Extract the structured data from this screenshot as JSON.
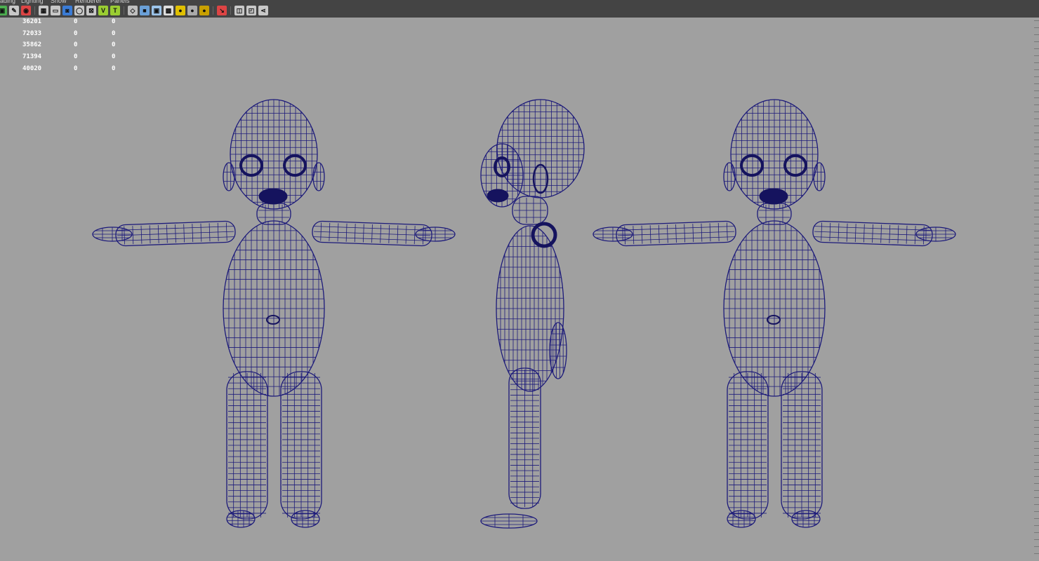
{
  "menu": [
    "ading",
    "Lighting",
    "Show",
    "Renderer",
    "Panels"
  ],
  "toolbar_icons": [
    {
      "name": "select-camera-icon",
      "glyph": "▣",
      "bg": "#4caf50"
    },
    {
      "name": "lock-camera-icon",
      "glyph": "✎",
      "bg": "#c8c8c8"
    },
    {
      "name": "bookmark-icon",
      "glyph": "◉",
      "bg": "#d44"
    },
    {
      "sep": true
    },
    {
      "name": "grid-icon",
      "glyph": "▦",
      "bg": "#c8c8c8"
    },
    {
      "name": "film-gate-icon",
      "glyph": "▭",
      "bg": "#c8c8c8"
    },
    {
      "name": "resolution-gate-icon",
      "glyph": "◙",
      "bg": "#3a7bd5"
    },
    {
      "name": "gate-mask-icon",
      "glyph": "◯",
      "bg": "#c8c8c8"
    },
    {
      "name": "field-chart-icon",
      "glyph": "⊠",
      "bg": "#c8c8c8"
    },
    {
      "name": "safe-action-icon",
      "glyph": "V",
      "bg": "#9acd32"
    },
    {
      "name": "safe-title-icon",
      "glyph": "T",
      "bg": "#9acd32"
    },
    {
      "sep": true
    },
    {
      "name": "wireframe-icon",
      "glyph": "◇",
      "bg": "#bfbfbf"
    },
    {
      "name": "smooth-shade-icon",
      "glyph": "■",
      "bg": "#6aa0d8"
    },
    {
      "name": "wireframe-on-shaded-icon",
      "glyph": "▣",
      "bg": "#9cc4ea"
    },
    {
      "name": "textured-icon",
      "glyph": "▩",
      "bg": "#dddddd"
    },
    {
      "name": "use-all-lights-icon",
      "glyph": "●",
      "bg": "#e0c000"
    },
    {
      "name": "shadows-icon",
      "glyph": "●",
      "bg": "#aaaaaa"
    },
    {
      "name": "screen-space-ao-icon",
      "glyph": "●",
      "bg": "#c8a000"
    },
    {
      "sep": true
    },
    {
      "name": "isolate-select-icon",
      "glyph": "↘",
      "bg": "#d44"
    },
    {
      "sep": true
    },
    {
      "name": "xray-icon",
      "glyph": "◫",
      "bg": "#c8c8c8"
    },
    {
      "name": "xray-joints-icon",
      "glyph": "◰",
      "bg": "#c8c8c8"
    },
    {
      "name": "share-icon",
      "glyph": "⋖",
      "bg": "#c8c8c8"
    }
  ],
  "hud": [
    [
      "36201",
      "0",
      "0"
    ],
    [
      "72033",
      "0",
      "0"
    ],
    [
      "35862",
      "0",
      "0"
    ],
    [
      "71394",
      "0",
      "0"
    ],
    [
      "40020",
      "0",
      "0"
    ]
  ],
  "colors": {
    "viewport_bg": "#a0a0a0",
    "toolbar_bg": "#444444",
    "wire": "#1c1a7a",
    "wire_dark": "#15135e"
  },
  "views": [
    "front-view",
    "side-view",
    "back-view"
  ]
}
